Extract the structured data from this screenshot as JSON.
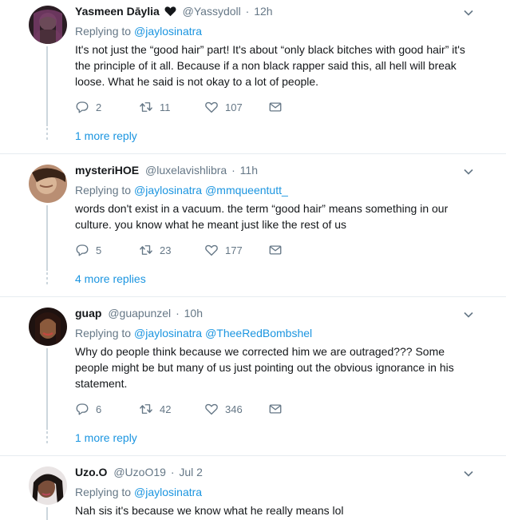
{
  "tweets": [
    {
      "name": "Yasmeen Dāylia",
      "handle": "@Yassydoll",
      "time": "12h",
      "replying_label": "Replying to",
      "mentions": [
        "@jaylosinatra"
      ],
      "text": "It's not just the “good hair” part! It's about “only black bitches with good hair” it's the principle of it all. Because if a non black rapper said this, all hell will break loose. What he said is not okay to a lot of people.",
      "replies": "2",
      "retweets": "11",
      "likes": "107",
      "more_replies": "1 more reply"
    },
    {
      "name": "mysteriHOE",
      "handle": "@luxelavishlibra",
      "time": "11h",
      "replying_label": "Replying to",
      "mentions": [
        "@jaylosinatra",
        "@mmqueentutt_"
      ],
      "text": "words don't exist in a vacuum. the term “good hair” means something in our culture. you know what he meant just like the rest of us",
      "replies": "5",
      "retweets": "23",
      "likes": "177",
      "more_replies": "4 more replies"
    },
    {
      "name": "guap",
      "handle": "@guapunzel",
      "time": "10h",
      "replying_label": "Replying to",
      "mentions": [
        "@jaylosinatra",
        "@TheeRedBombshel"
      ],
      "text": "Why do people think because we corrected him we are outraged??? Some people might be but many of us just pointing out the obvious ignorance in his statement.",
      "replies": "6",
      "retweets": "42",
      "likes": "346",
      "more_replies": "1 more reply"
    },
    {
      "name": "Uzo.O",
      "handle": "@UzoO19",
      "time": "Jul 2",
      "replying_label": "Replying to",
      "mentions": [
        "@jaylosinatra"
      ],
      "text": "Nah sis it's because we know what he really means lol"
    }
  ],
  "colors": {
    "link": "#1b95e0",
    "muted": "#657786",
    "text": "#14171a",
    "divider": "#e6ecf0"
  },
  "icons": {
    "reply": "reply-icon",
    "retweet": "retweet-icon",
    "like": "heart-icon",
    "dm": "envelope-icon",
    "caret": "chevron-down-icon",
    "badge": "black-heart-icon"
  }
}
